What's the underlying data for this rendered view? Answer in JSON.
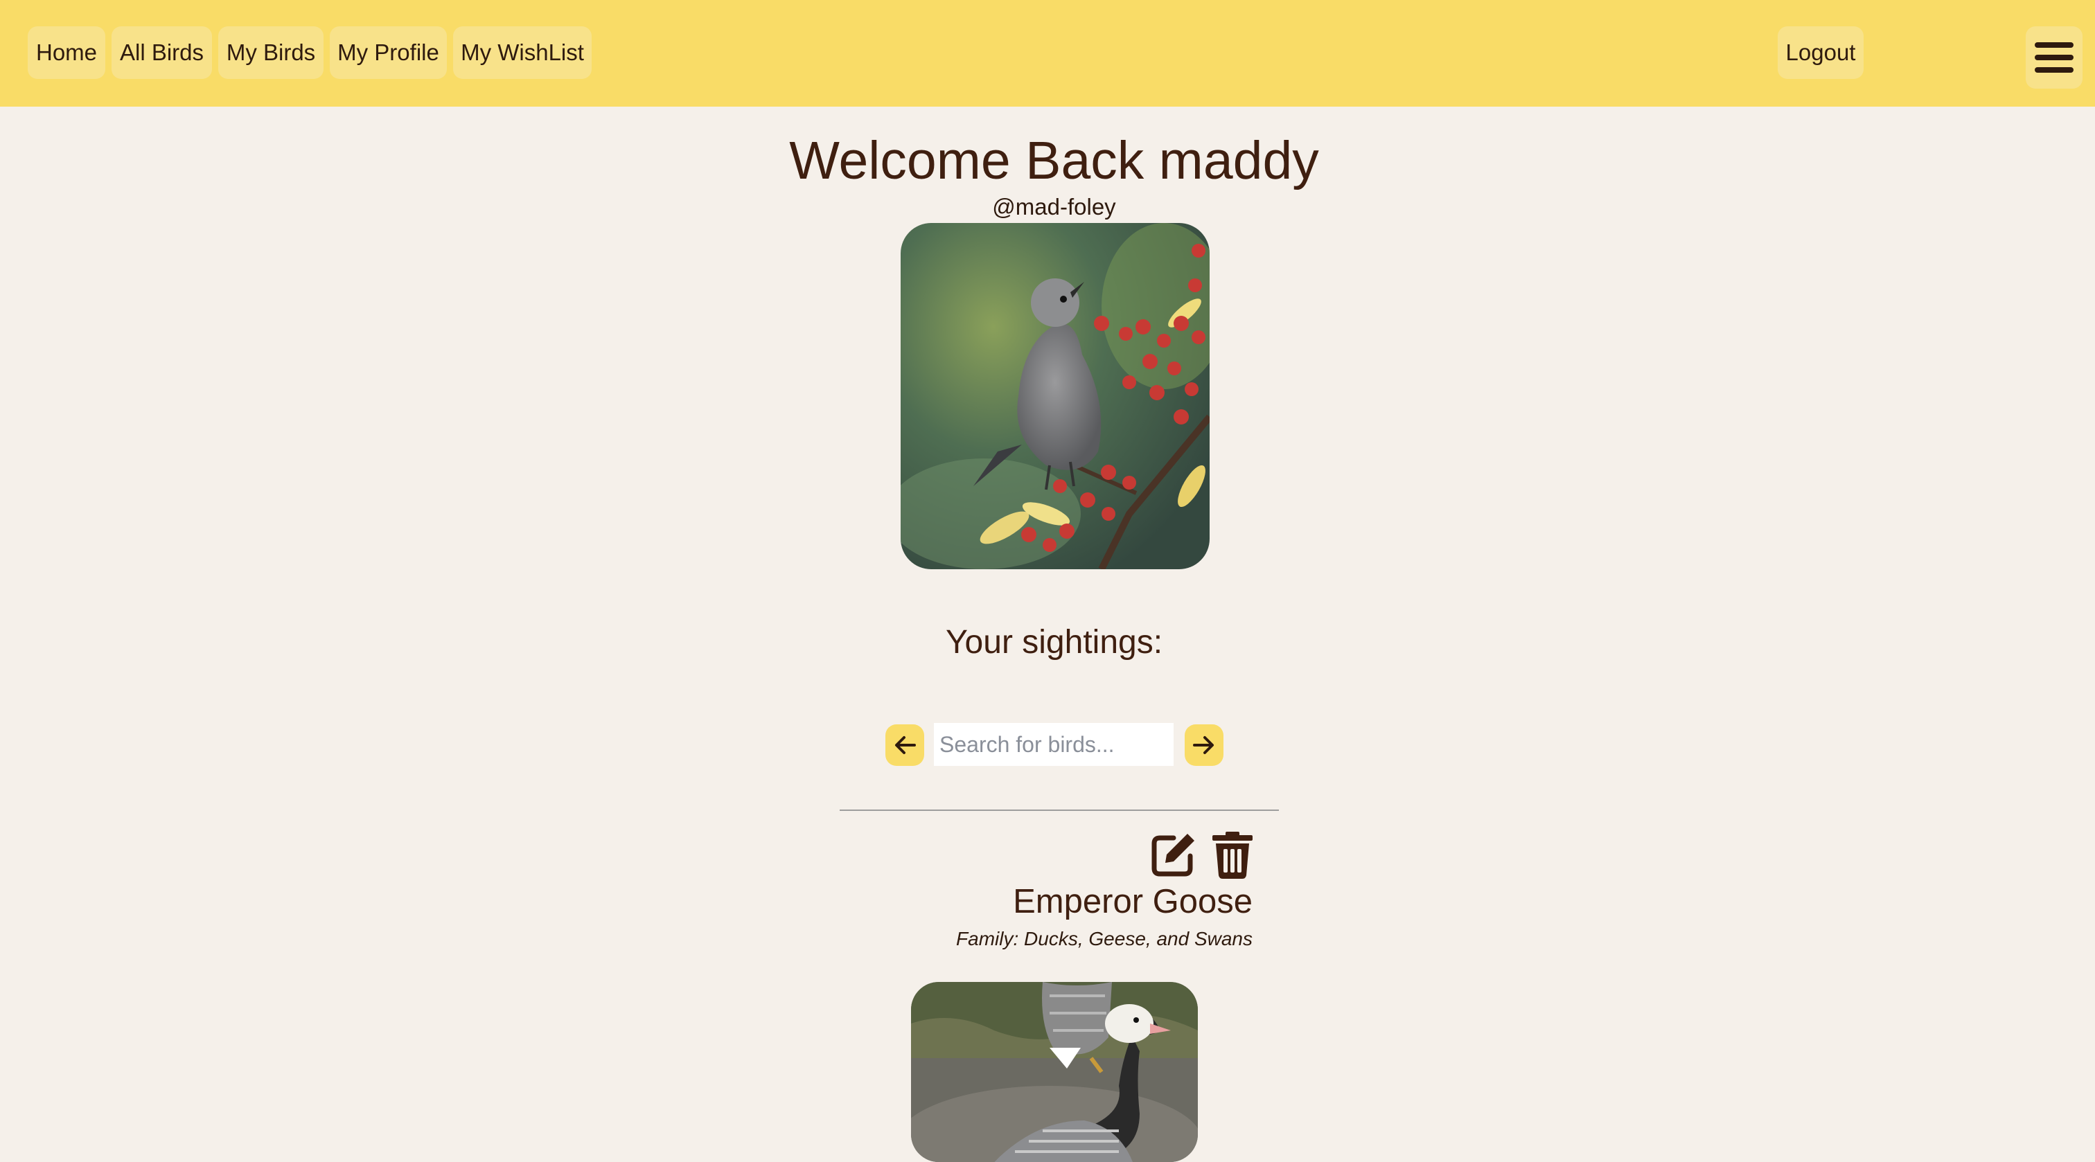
{
  "nav": {
    "left_items": [
      {
        "label": "Home"
      },
      {
        "label": "All Birds"
      },
      {
        "label": "My Birds"
      },
      {
        "label": "My Profile"
      },
      {
        "label": "My WishList"
      }
    ],
    "logout_label": "Logout",
    "menu_icon": "hamburger-menu-icon"
  },
  "profile": {
    "welcome_text": "Welcome Back maddy",
    "handle": "@mad-foley",
    "photo_subject": "gray bird perched on branch with red berries"
  },
  "sightings": {
    "title": "Your sightings:",
    "search_placeholder": "Search for birds...",
    "prev_icon": "arrow-left-icon",
    "next_icon": "arrow-right-icon"
  },
  "sighting_card": {
    "bird_name": "Emperor Goose",
    "family_text": "Family: Ducks, Geese, and Swans",
    "edit_icon": "edit-icon",
    "delete_icon": "trash-icon",
    "photo_subject": "emperor goose standing on ground"
  },
  "colors": {
    "navbar": "#f9dc67",
    "nav_button": "#f8e28a",
    "background": "#f5f0ea",
    "text_brown": "#3f1f10"
  }
}
